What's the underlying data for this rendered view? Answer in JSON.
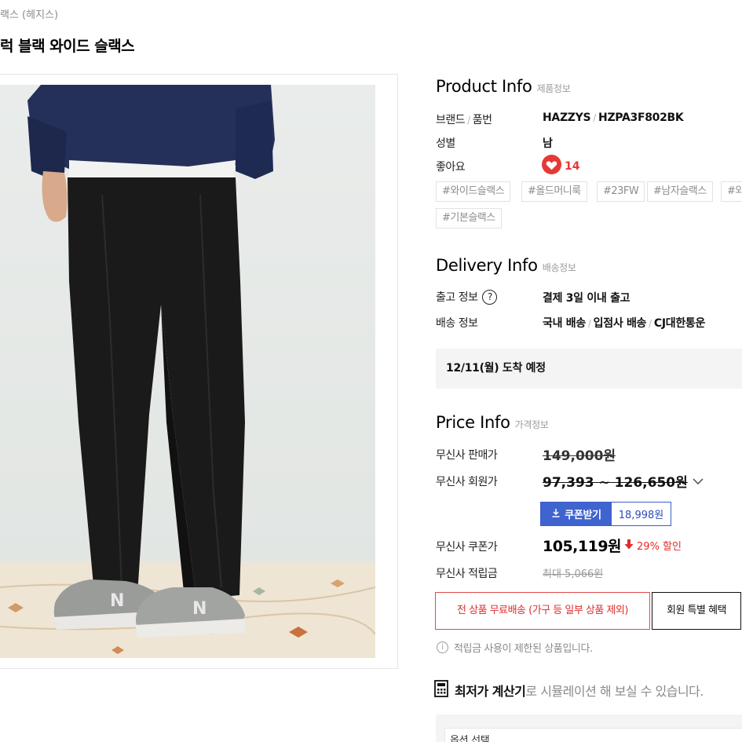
{
  "breadcrumb": "랙스 (헤지스)",
  "product_title": "럭 블랙 와이드 슬랙스",
  "product_info": {
    "title": "Product Info",
    "subtitle": "제품정보",
    "brand_label_a": "브랜드",
    "brand_label_b": "품번",
    "brand": "HAZZYS",
    "sku": "HZPA3F802BK",
    "gender_label": "성별",
    "gender": "남",
    "likes_label": "좋아요",
    "likes": "14",
    "tags": [
      "#와이드슬랙스",
      "#올드머니룩",
      "#23FW",
      "#남자슬랙스",
      "#와",
      "#기본슬랙스"
    ]
  },
  "delivery_info": {
    "title": "Delivery Info",
    "subtitle": "배송정보",
    "release_label": "출고 정보",
    "release_value": "결제 3일 이내 출고",
    "ship_label": "배송 정보",
    "ship_a": "국내 배송",
    "ship_b": "입점사 배송",
    "ship_c": "CJ대한통운",
    "arrival": "12/11(월) 도착 예정"
  },
  "price_info": {
    "title": "Price Info",
    "subtitle": "가격정보",
    "sale_label": "무신사 판매가",
    "sale_price": "149,000원",
    "member_label": "무신사 회원가",
    "member_price": "97,393 ~ 126,650원",
    "coupon_button": "쿠폰받기",
    "coupon_amount": "18,998원",
    "coupon_label": "무신사 쿠폰가",
    "coupon_price": "105,119원",
    "discount": "29% 할인",
    "points_label": "무신사 적립금",
    "points": "최대 5,066원",
    "free_shipping": "전 상품 무료배송 (가구 등 일부 상품 제외)",
    "member_benefit": "회원 특별 혜택",
    "notice": "적립금 사용이 제한된 상품입니다.",
    "calc_bold": "최저가 계산기",
    "calc_rest": "로 시뮬레이션 해 보실 수 있습니다.",
    "option_label": "옵션 선택"
  },
  "colors": {
    "accent_blue": "#3f63cf",
    "sale_red": "#e02b2b",
    "heart_red": "#e53935"
  }
}
